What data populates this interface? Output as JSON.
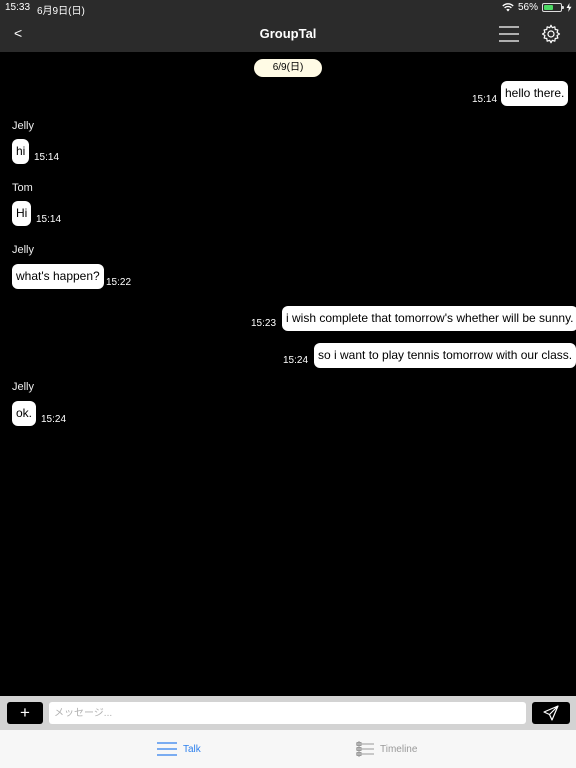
{
  "status_bar": {
    "time": "15:33",
    "date": "6月9日(日)",
    "battery": "56%",
    "battery_level": 0.56
  },
  "nav": {
    "back_label": "<",
    "title": "GroupTal",
    "menu_icon": "hamburger-menu-icon",
    "settings_icon": "gear-icon"
  },
  "chat": {
    "date_divider": "6/9(日)",
    "messages": [
      {
        "sender": "",
        "text": "hello there.",
        "time": "15:14",
        "side": "right"
      },
      {
        "sender": "Jelly",
        "text": "hi",
        "time": "15:14",
        "side": "left"
      },
      {
        "sender": "Tom",
        "text": "Hi",
        "time": "15:14",
        "side": "left"
      },
      {
        "sender": "Jelly",
        "text": "what's happen?",
        "time": "15:22",
        "side": "left"
      },
      {
        "sender": "",
        "text": "i wish complete that tomorrow's whether will be sunny.",
        "time": "15:23",
        "side": "right"
      },
      {
        "sender": "",
        "text": "so i want to play tennis tomorrow with our class.",
        "time": "15:24",
        "side": "right"
      },
      {
        "sender": "Jelly",
        "text": "ok.",
        "time": "15:24",
        "side": "left"
      }
    ]
  },
  "composer": {
    "plus_label": "+",
    "placeholder": "メッセージ...",
    "send_icon": "send-icon"
  },
  "tabs": [
    {
      "label": "Talk",
      "icon": "list-icon",
      "active": true
    },
    {
      "label": "Timeline",
      "icon": "timeline-icon",
      "active": false
    }
  ],
  "colors": {
    "accent": "#2f80ed",
    "bar_bg": "#2b2b2b",
    "date_pill_bg": "#fffbe5",
    "battery_green": "#4cd964"
  }
}
